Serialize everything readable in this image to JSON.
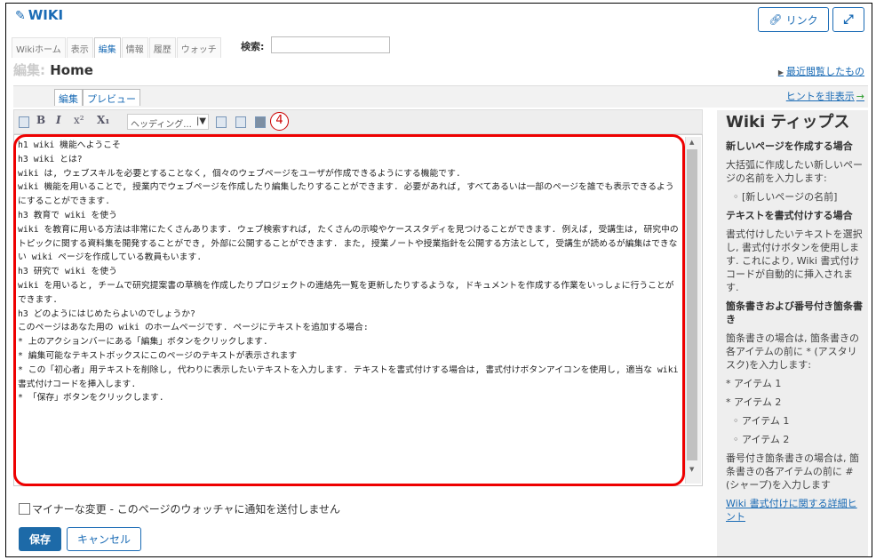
{
  "header": {
    "title": "WIKI",
    "title_icon": "edit-icon",
    "link_button": "リンク",
    "expand_icon": "expand-icon"
  },
  "tabs": [
    "Wikiホーム",
    "表示",
    "編集",
    "情報",
    "履歴",
    "ウォッチ"
  ],
  "search": {
    "label": "検索:",
    "value": ""
  },
  "page": {
    "title_prefix": "編集:",
    "title": "Home",
    "recent_link": "最近閲覧したもの"
  },
  "editor_tabs": {
    "edit": "編集",
    "preview": "プレビュー"
  },
  "hint_link": "ヒントを非表示",
  "toolbar": {
    "bold": "B",
    "italic": "I",
    "superscript": "x²",
    "subscript": "X₁",
    "heading_select": "ヘッディング...",
    "step_marker": "4"
  },
  "editor_lines": [
    "h1 wiki 機能へようこそ",
    "",
    "h3 wiki とは?",
    "",
    "wiki は, ウェブスキルを必要とすることなく, 個々のウェブページをユーザが作成できるようにする機能です.",
    "",
    "wiki 機能を用いることで, 授業内でウェブページを作成したり編集したりすることができます. 必要があれば, すべてあるいは一部のページを誰でも表示できるようにすることができます.",
    "",
    "h3 教育で wiki を使う",
    "wiki を教育に用いる方法は非常にたくさんあります. ウェブ検索すれば, たくさんの示唆やケーススタディを見つけることができます. 例えば, 受講生は, 研究中のトピックに関する資料集を開発することができ, 外部に公開することができます. また, 授業ノートや授業指針を公開する方法として, 受講生が読めるが編集はできない wiki ページを作成している教員もいます.",
    "",
    "h3 研究で wiki を使う",
    "wiki を用いると, チームで研究提案書の草稿を作成したりプロジェクトの連絡先一覧を更新したりするような, ドキュメントを作成する作業をいっしょに行うことができます.",
    "",
    "h3 どのようにはじめたらよいのでしょうか?",
    "このページはあなた用の wiki のホームページです. ページにテキストを追加する場合:",
    "* 上のアクションバーにある「編集」ボタンをクリックします.",
    "* 編集可能なテキストボックスにこのページのテキストが表示されます",
    "* この「初心者」用テキストを削除し, 代わりに表示したいテキストを入力します. テキストを書式付けする場合は, 書式付けボタンアイコンを使用し, 適当な wiki 書式付けコードを挿入します.",
    "* 「保存」ボタンをクリックします."
  ],
  "minor_change": "マイナーな変更 - このページのウォッチャに通知を送付しません",
  "buttons": {
    "save": "保存",
    "cancel": "キャンセル"
  },
  "tips": {
    "title": "Wiki ティップス",
    "s1_heading": "新しいページを作成する場合",
    "s1_text": "大括弧に作成したい新しいページの名前を入力します:",
    "s1_item": "[新しいページの名前]",
    "s2_heading": "テキストを書式付けする場合",
    "s2_text": "書式付けしたいテキストを選択し, 書式付けボタンを使用します. これにより, Wiki 書式付けコードが自動的に挿入されます.",
    "s3_heading": "箇条書きおよび番号付き箇条書き",
    "s3_text": "箇条書きの場合は, 箇条書きの各アイテムの前に * (アスタリスク)を入力します:",
    "s3_item1": "* アイテム 1",
    "s3_item2": "* アイテム 2",
    "s3_sub1": "アイテム 1",
    "s3_sub2": "アイテム 2",
    "s4_text": "番号付き箇条書きの場合は, 箇条書きの各アイテムの前に #(シャープ)を入力します",
    "more_link": "Wiki 書式付けに関する詳細ヒント"
  },
  "colors": {
    "accent": "#1a6bb5",
    "highlight": "#e00000",
    "save_bg": "#1d6aa8"
  }
}
